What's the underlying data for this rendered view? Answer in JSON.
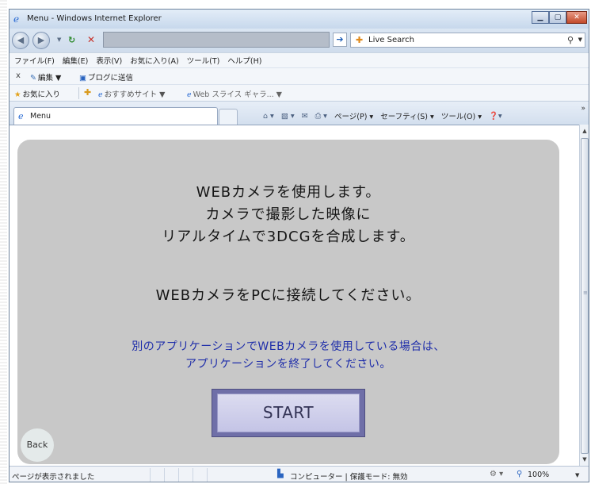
{
  "window": {
    "title": "Menu - Windows Internet Explorer",
    "controls": [
      "minimize",
      "maximize",
      "close"
    ]
  },
  "navigation": {
    "search_label": "Live Search"
  },
  "menubar": {
    "items": [
      "ファイル(F)",
      "編集(E)",
      "表示(V)",
      "お気に入り(A)",
      "ツール(T)",
      "ヘルプ(H)"
    ]
  },
  "links_toolbar": {
    "close": "x",
    "edit": "編集",
    "blog": "ブログに送信"
  },
  "favorites_bar": {
    "favorites": "お気に入り",
    "suggested_sites": "おすすめサイト",
    "web_slice": "Web スライス ギャラ..."
  },
  "tab": {
    "label": "Menu"
  },
  "command_bar": {
    "page": "ページ(P)",
    "safety": "セーフティ(S)",
    "tools": "ツール(O)",
    "more": "»"
  },
  "page": {
    "line1": "WEBカメラを使用します。",
    "line2": "カメラで撮影した映像に",
    "line3": "リアルタイムで3DCGを合成します。",
    "connect": "WEBカメラをPCに接続してください。",
    "warning1": "別のアプリケーションでWEBカメラを使用している場合は、",
    "warning2": "アプリケーションを終了してください。",
    "start": "START",
    "back": "Back"
  },
  "status": {
    "text": "ページが表示されました",
    "zone": "コンピューター | 保護モード: 無効",
    "zoom": "100%"
  }
}
